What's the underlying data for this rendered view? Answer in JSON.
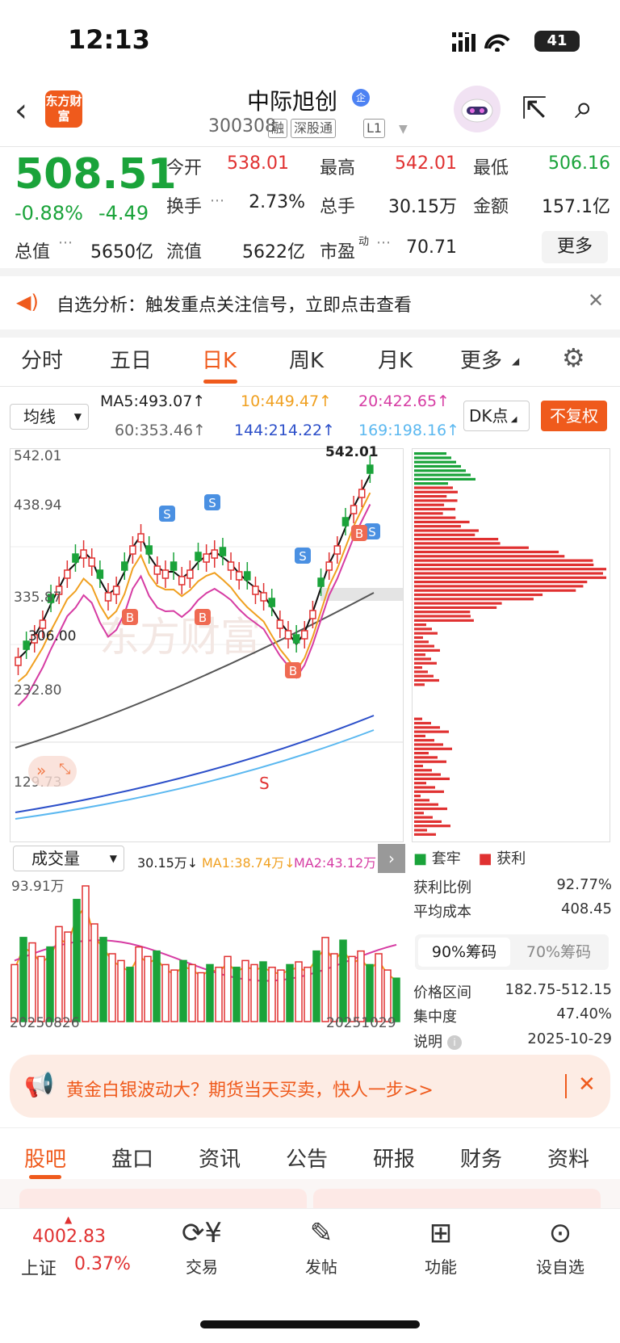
{
  "status_bar": {
    "time": "12:13",
    "battery": "41"
  },
  "header": {
    "logo_text": "东方财富",
    "stock_name": "中际旭创",
    "badge": "企",
    "stock_code": "300308",
    "tags": [
      "融",
      "深股通",
      "L1"
    ]
  },
  "quote": {
    "price": "508.51",
    "change_pct": "-0.88%",
    "change_amt": "-4.49",
    "rows": [
      [
        {
          "label": "今开",
          "value": "538.01",
          "color": "#e03131"
        },
        {
          "label": "最高",
          "value": "542.01",
          "color": "#e03131"
        },
        {
          "label": "最低",
          "value": "506.16",
          "color": "#1aa33a"
        }
      ],
      [
        {
          "label": "换手",
          "value": "2.73%",
          "color": "#222"
        },
        {
          "label": "总手",
          "value": "30.15万",
          "color": "#222"
        },
        {
          "label": "金额",
          "value": "157.1亿",
          "color": "#222"
        }
      ],
      [
        {
          "label": "总值",
          "value": "5650亿",
          "color": "#222"
        },
        {
          "label": "流值",
          "value": "5622亿",
          "color": "#222"
        },
        {
          "label": "市盈",
          "sup": "动",
          "value": "70.71",
          "color": "#222"
        }
      ]
    ],
    "more_label": "更多"
  },
  "notice": {
    "text": "自选分析：触发重点关注信号，立即点击查看"
  },
  "period_tabs": [
    "分时",
    "五日",
    "日K",
    "周K",
    "月K",
    "更多"
  ],
  "active_period": "日K",
  "indicators": {
    "selector": "均线",
    "ma": [
      {
        "label": "MA5:493.07↑",
        "color": "#222"
      },
      {
        "label": "10:449.47↑",
        "color": "#f0a020"
      },
      {
        "label": "20:422.65↑",
        "color": "#d63ca3"
      },
      {
        "label": "60:353.46↑",
        "color": "#666"
      },
      {
        "label": "144:214.22↑",
        "color": "#2c4fc9"
      },
      {
        "label": "169:198.16↑",
        "color": "#5bb8f0"
      }
    ],
    "dk_button": "DK点",
    "fuquan_button": "不复权"
  },
  "kline": {
    "axis_labels": [
      "542.01",
      "438.94",
      "335.87",
      "232.80",
      "129.73"
    ],
    "high_label": "542.01",
    "low_label": "306.00",
    "signal_s": "S",
    "watermark": "东方财富"
  },
  "chip": {
    "legend": [
      {
        "label": "套牢",
        "color": "#1aa33a"
      },
      {
        "label": "获利",
        "color": "#e03131"
      }
    ],
    "profit_ratio_label": "获利比例",
    "profit_ratio": "92.77%",
    "avg_cost_label": "平均成本",
    "avg_cost": "408.45",
    "seg_a": "90%筹码",
    "seg_b": "70%筹码",
    "price_range_label": "价格区间",
    "price_range": "182.75-512.15",
    "concentration_label": "集中度",
    "concentration": "47.40%",
    "note_label": "说明",
    "note_date": "2025-10-29"
  },
  "volume": {
    "selector": "成交量",
    "current": "30.15万↓",
    "ma1": "MA1:38.74万↓",
    "ma2": "MA2:43.12万↓",
    "max_label": "93.91万",
    "start_date": "20250826",
    "end_date": "20251029"
  },
  "ad": {
    "text": "黄金白银波动大？期货当天买卖，快人一步>>"
  },
  "bottom_tabs": [
    "股吧",
    "盘口",
    "资讯",
    "公告",
    "研报",
    "财务",
    "资料"
  ],
  "nav": {
    "index_value": "4002.83",
    "index_name": "上证",
    "index_pct": "0.37%",
    "items": [
      {
        "label": "交易",
        "icon": "yen-exchange-icon"
      },
      {
        "label": "发帖",
        "icon": "edit-icon"
      },
      {
        "label": "功能",
        "icon": "grid-icon"
      },
      {
        "label": "设自选",
        "icon": "more-circle-icon"
      }
    ]
  },
  "chart_data": {
    "type": "candlestick",
    "ylim": [
      129.73,
      542.01
    ],
    "last_close": 508.51,
    "day_high": 542.01,
    "day_low": 506.16,
    "period_high": 542.01,
    "period_low": 306.0
  }
}
